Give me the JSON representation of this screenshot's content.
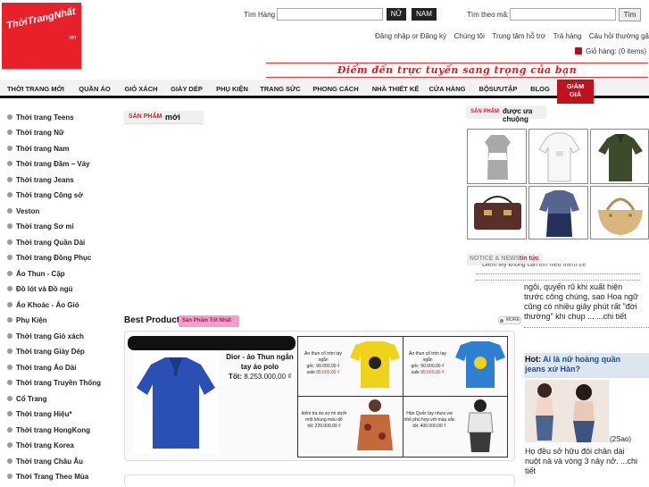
{
  "logo": {
    "text": "ThờiTrangNhất",
    "suffix": ".vn"
  },
  "search": {
    "label": "Tìm Hàng",
    "btn_nu": "NỮ",
    "btn_nam": "NAM",
    "code_label": "Tìm theo mã:",
    "code_btn": "Tìm"
  },
  "top_links": [
    "Đăng nhập or Đăng ký",
    "Chúng tôi",
    "Trung tâm hỗ trợ",
    "Trả hàng",
    "Câu hỏi thường gặp"
  ],
  "cart": {
    "label": "Giỏ hàng: (0 items)"
  },
  "slogan": "Điểm đến trực tuyến sang trọng của bạn",
  "nav": [
    "THỜI TRANG MỚI",
    "QUẦN ÁO",
    "GIỎ XÁCH",
    "GIÀY DÉP",
    "PHỤ KIỆN",
    "TRANG SỨC",
    "PHONG CÁCH",
    "NHÀ THIẾT KẾ",
    "CỬA HÀNG",
    "BỘSƯUTẬP",
    "BLOG",
    "GIẢM GIÁ"
  ],
  "nav_active_line1": "GIẢM",
  "nav_active_line2": "GIÁ",
  "sidebar": [
    "Thời trang Teens",
    "Thời trang Nữ",
    "Thời trang Nam",
    "Thời trang Đầm – Váy",
    "Thời trang Jeans",
    "Thời trang Công sở",
    "Veston",
    "Thời trang Sơ mi",
    "Thời trang Quần Dài",
    "Thời trang Đồng Phục",
    "Áo Thun - Cặp",
    "Đồ lót và Đồ ngủ",
    "Áo Khoác - Áo Gió",
    "Phụ Kiện",
    "Thời trang Giỏ xách",
    "Thời trang Giày Dép",
    "Thời trang Áo Dài",
    "Thời trang Truyền Thống",
    "Cổ Trang",
    "Thời trang Hiệu*",
    "Thời trang HongKong",
    "Thời trang Korea",
    "Thời trang Châu Âu",
    "Thời Trang Theo Mùa"
  ],
  "new_products": {
    "part1": "SẢN PHẨM",
    "part2": "mới"
  },
  "featured": {
    "part1": "SẢN PHẨM",
    "part2": "được ưa chuộng"
  },
  "notice": {
    "part1": "NOTICE & NEWS",
    "part2": "tin tức"
  },
  "best": {
    "title": "Best Product",
    "badge": "Sản Phẩm Tốt Nhất",
    "more": "MORE"
  },
  "main_product": {
    "name": "Dior - áo Thun ngắn tay áo polo",
    "price_label": "Tốt:",
    "price": "8.253.000,00 ₫"
  },
  "small_products": [
    {
      "name": "Áo thun cổ tròn tay ngắn",
      "goc": "gốc: 90.000,00 ₫",
      "sale": "85.500,00 ₫"
    },
    {
      "name": "Áo thun cổ tròn tay ngắn",
      "goc": "gốc: 90.000,00 ₫",
      "sale": "85.500,00 ₫"
    },
    {
      "name": "kiểm tra áo sơ mi dưới một khung màu đỏ",
      "goc": "tốt: 229.000,00 ₫",
      "sale": ""
    },
    {
      "name": "Hàn Quốc tay nhưa vai nhỏ phù hợp với màu sắc",
      "goc": "tốt: 400.000,00 ₫",
      "sale": ""
    }
  ],
  "sale_label": "sale",
  "news": {
    "cut_line": "Diễm My không cần tìm hiểu thêm trẻ",
    "para1_l1": "ngôi, quyến rũ khi xuất hiện",
    "para1_l2": "trước công chúng, sao Hoa ngữ",
    "para1_l3": "cũng có nhiều giây phút rất \"đời",
    "para1_l4": "thường\" khi chụp ... ...chi tiết",
    "hot_prefix": "Hot:",
    "hot_l1": " Ai là nữ hoàng quần",
    "hot_l2": "jeans xứ Hàn?",
    "source": "(2Sao)",
    "para2_l1": "Họ đều sở hữu đôi chân dài",
    "para2_l2": "nuột nà và vòng 3 nảy nở. ...chi",
    "para2_l3": "tiết"
  }
}
